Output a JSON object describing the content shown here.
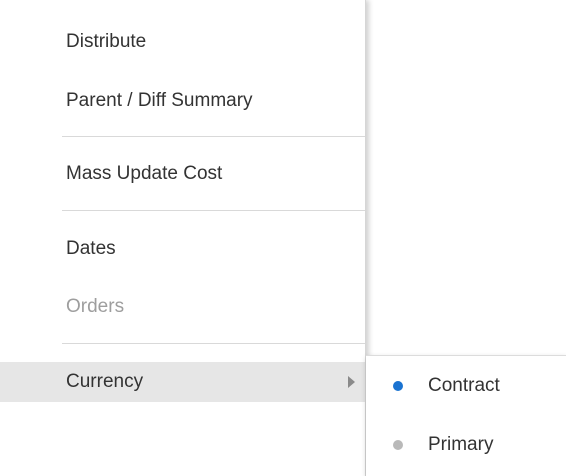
{
  "menu": {
    "items": [
      {
        "label": "Distribute",
        "disabled": false
      },
      {
        "label": "Parent / Diff Summary",
        "disabled": false
      },
      {
        "label": "Mass Update Cost",
        "disabled": false
      },
      {
        "label": "Dates",
        "disabled": false
      },
      {
        "label": "Orders",
        "disabled": true
      },
      {
        "label": "Currency",
        "disabled": false,
        "has_submenu": true,
        "active": true
      }
    ]
  },
  "submenu": {
    "items": [
      {
        "label": "Contract",
        "selected": true,
        "dot_color": "#1a73d1"
      },
      {
        "label": "Primary",
        "selected": false,
        "dot_color": "#b9b9b9"
      }
    ]
  },
  "icons": {
    "submenu_arrow": "chevron-right-icon",
    "selected_radio": "radio-selected-icon",
    "unselected_radio": "radio-unselected-icon"
  },
  "colors": {
    "text": "#333333",
    "disabled_text": "#9e9e9e",
    "active_background": "#e6e6e6",
    "selected_dot": "#1a73d1",
    "unselected_dot": "#b9b9b9"
  }
}
